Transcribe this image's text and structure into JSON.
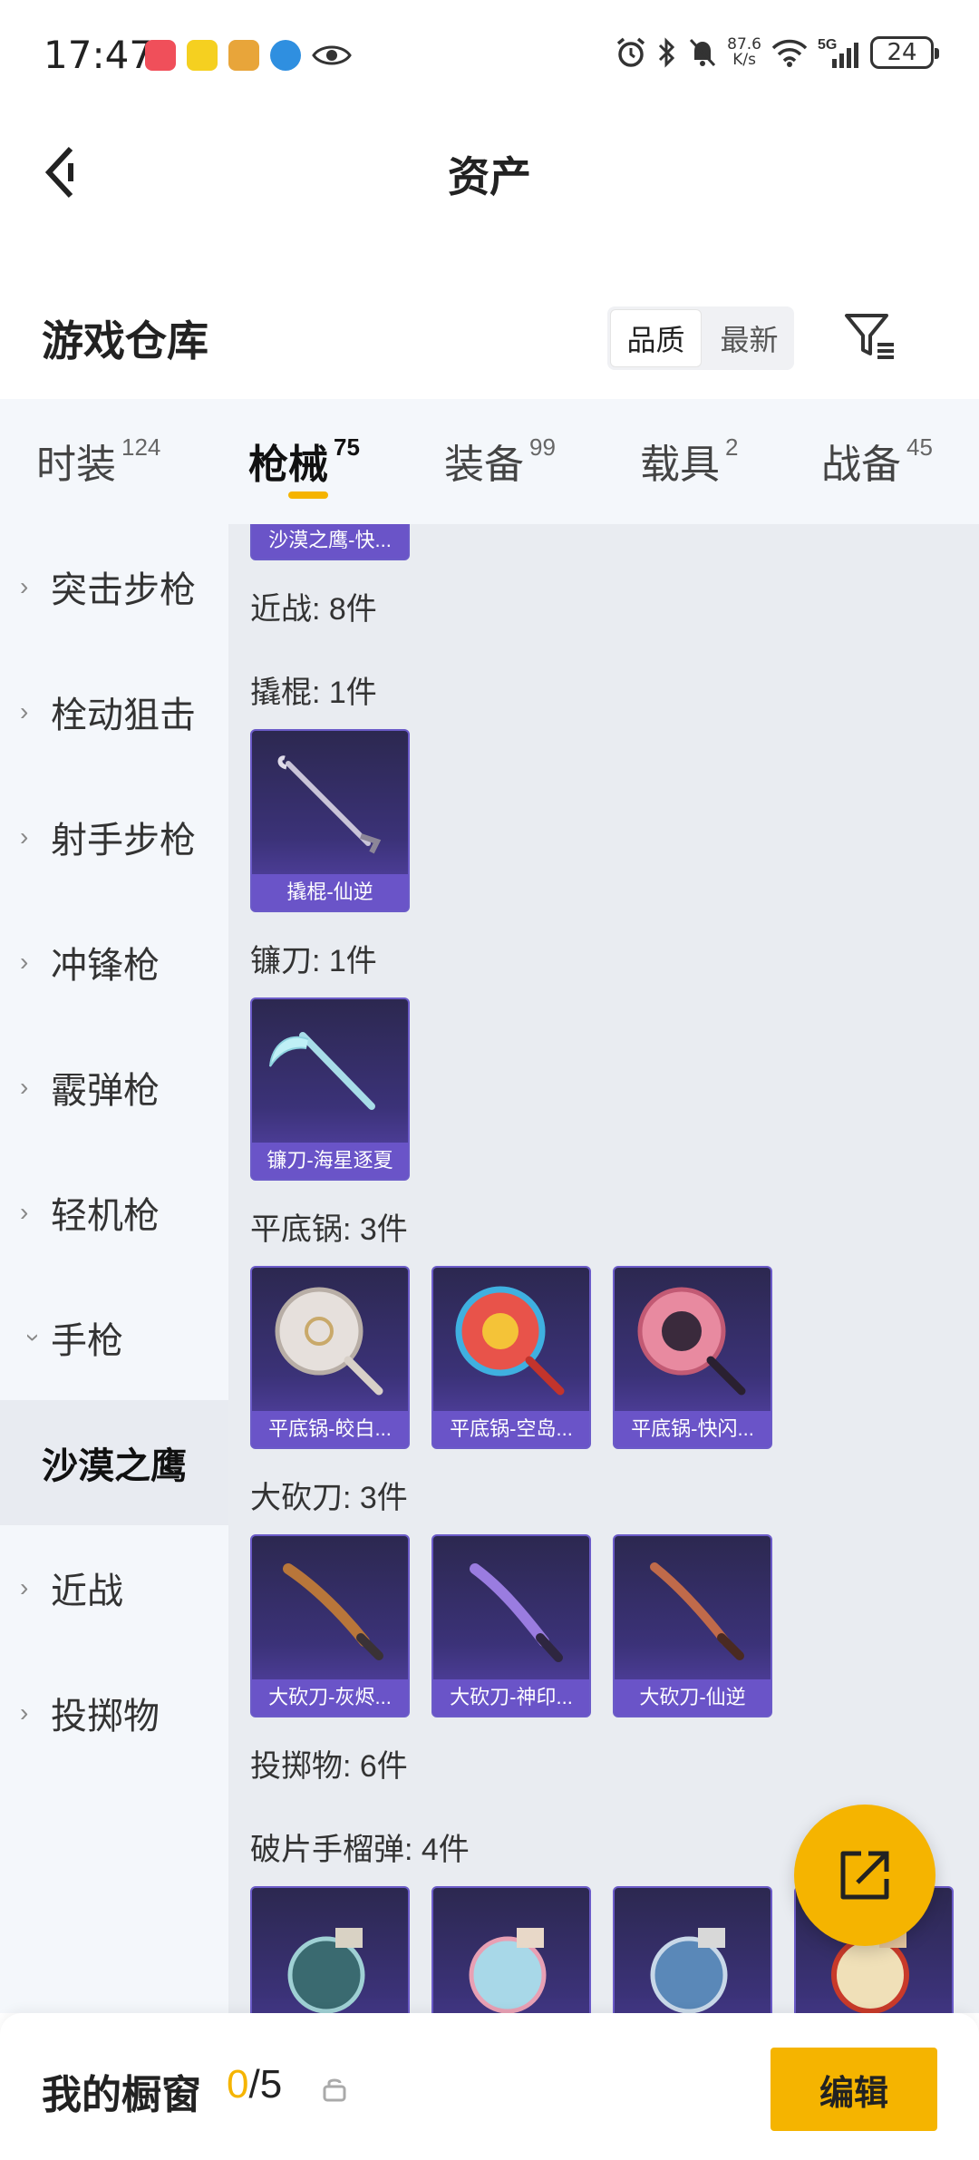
{
  "status_bar": {
    "time": "17:47",
    "net_speed_value": "87.6",
    "net_speed_unit": "K/s",
    "signal_label": "5G",
    "battery": "24"
  },
  "header": {
    "title": "资产"
  },
  "warehouse": {
    "title": "游戏仓库",
    "sort_options": [
      "品质",
      "最新"
    ]
  },
  "category_tabs": [
    {
      "label": "时装",
      "count": "124"
    },
    {
      "label": "枪械",
      "count": "75"
    },
    {
      "label": "装备",
      "count": "99"
    },
    {
      "label": "载具",
      "count": "2"
    },
    {
      "label": "战备",
      "count": "45"
    }
  ],
  "sidebar": {
    "items": [
      {
        "label": "突击步枪"
      },
      {
        "label": "栓动狙击"
      },
      {
        "label": "射手步枪"
      },
      {
        "label": "冲锋枪"
      },
      {
        "label": "霰弹枪"
      },
      {
        "label": "轻机枪"
      },
      {
        "label": "手枪"
      },
      {
        "label": "沙漠之鹰"
      },
      {
        "label": "近战"
      },
      {
        "label": "投掷物"
      }
    ]
  },
  "content": {
    "partial_card_name": "沙漠之鹰-快...",
    "sections": [
      {
        "label": "近战: 8件"
      },
      {
        "label": "撬棍: 1件",
        "cards": [
          "撬棍-仙逆"
        ]
      },
      {
        "label": "镰刀: 1件",
        "cards": [
          "镰刀-海星逐夏"
        ]
      },
      {
        "label": "平底锅: 3件",
        "cards": [
          "平底锅-皎白...",
          "平底锅-空岛...",
          "平底锅-快闪..."
        ]
      },
      {
        "label": "大砍刀: 3件",
        "cards": [
          "大砍刀-灰烬...",
          "大砍刀-神印...",
          "大砍刀-仙逆"
        ]
      },
      {
        "label": "投掷物: 6件"
      },
      {
        "label": "破片手榴弹: 4件"
      }
    ]
  },
  "bottom_bar": {
    "title": "我的橱窗",
    "current": "0",
    "total": "/5",
    "edit_label": "编辑"
  },
  "colors": {
    "accent": "#f5b400",
    "card_name_bg": "#6a54c8",
    "content_bg": "#e9ecf1",
    "sidebar_bg": "#f4f7fb"
  }
}
